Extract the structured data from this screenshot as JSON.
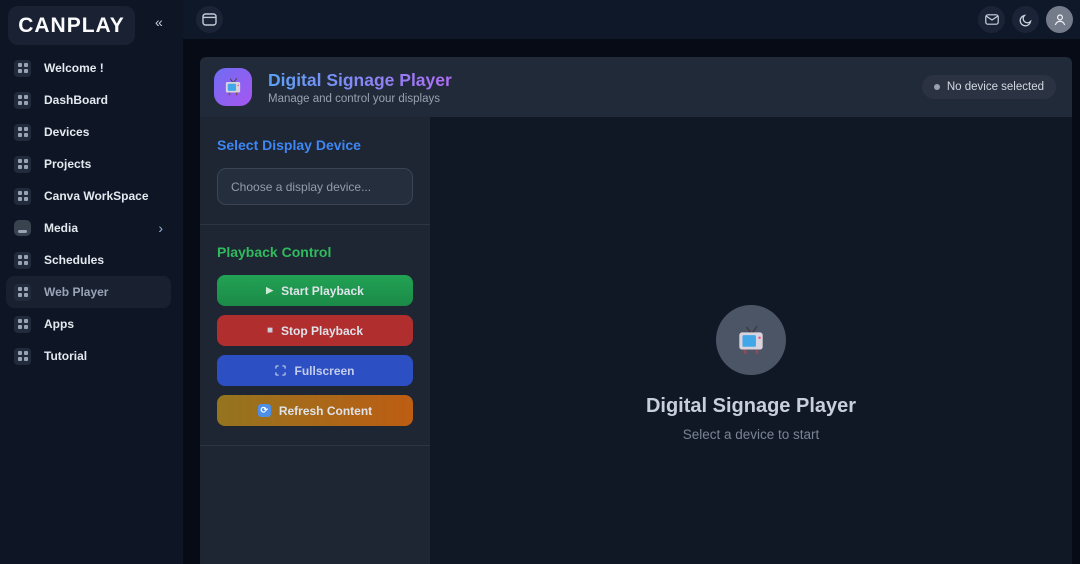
{
  "brand": {
    "logo": "CANPLAY"
  },
  "glyphs": {
    "collapse": "«",
    "chevron_right": "›",
    "play": "▶",
    "stop": "■",
    "refresh": "⟳"
  },
  "sidebar": {
    "items": [
      {
        "label": "Welcome !"
      },
      {
        "label": "DashBoard"
      },
      {
        "label": "Devices"
      },
      {
        "label": "Projects"
      },
      {
        "label": "Canva WorkSpace"
      },
      {
        "label": "Media",
        "has_submenu": true
      },
      {
        "label": "Schedules"
      },
      {
        "label": "Web Player",
        "active": true
      },
      {
        "label": "Apps"
      },
      {
        "label": "Tutorial"
      }
    ]
  },
  "header": {
    "title": "Digital Signage Player",
    "subtitle": "Manage and control your displays",
    "badge": "No device selected"
  },
  "controls": {
    "select_heading": "Select Display Device",
    "device_placeholder": "Choose a display device...",
    "playback_heading": "Playback Control",
    "buttons": [
      {
        "label": "Start Playback"
      },
      {
        "label": "Stop Playback"
      },
      {
        "label": "Fullscreen"
      },
      {
        "label": "Refresh Content"
      }
    ]
  },
  "empty_state": {
    "title": "Digital Signage Player",
    "subtitle": "Select a device to start"
  },
  "colors": {
    "accent_blue": "#3f86f5",
    "accent_green": "#30ba5e",
    "start_green": "#1f9a4f",
    "stop_red": "#b02e2e",
    "fullscreen_blue": "#2c4fc4",
    "refresh_orange": "#bd5d13",
    "icon_gradient": "#6f6cf2 → #a757f0",
    "title_gradient": "#5aa2f7 → #b06df5"
  }
}
